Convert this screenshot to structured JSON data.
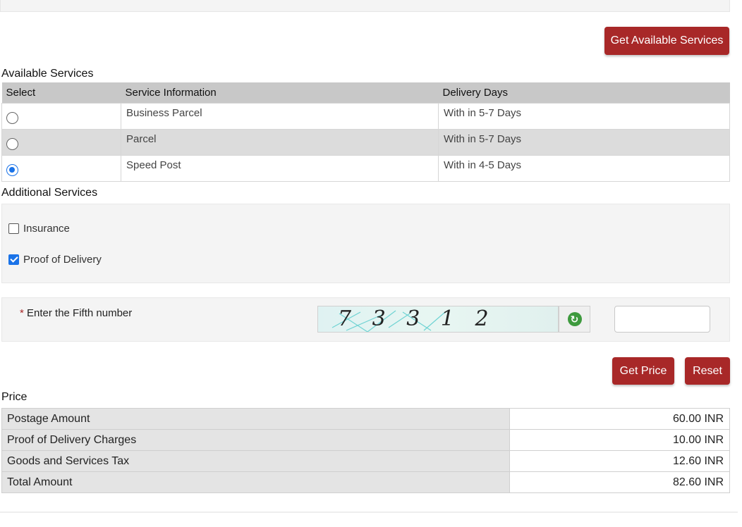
{
  "buttons": {
    "get_services": "Get Available Services",
    "get_price": "Get Price",
    "reset": "Reset"
  },
  "available_services": {
    "title": "Available Services",
    "headers": [
      "Select",
      "Service Information",
      "Delivery Days"
    ],
    "rows": [
      {
        "service": "Business Parcel",
        "days": "With in 5-7 Days",
        "selected": false
      },
      {
        "service": "Parcel",
        "days": "With in 5-7 Days",
        "selected": false
      },
      {
        "service": "Speed Post",
        "days": "With in 4-5 Days",
        "selected": true
      }
    ]
  },
  "additional_services": {
    "title": "Additional Services",
    "options": [
      {
        "label": "Insurance",
        "checked": false
      },
      {
        "label": "Proof of Delivery",
        "checked": true
      }
    ]
  },
  "captcha": {
    "required_mark": "*",
    "label": "Enter the Fifth number",
    "image_text": "7 3 3 1 2",
    "refresh_icon": "refresh-icon",
    "input_value": ""
  },
  "price": {
    "title": "Price",
    "rows": [
      {
        "label": "Postage Amount",
        "value": "60.00 INR"
      },
      {
        "label": "Proof of Delivery Charges",
        "value": "10.00 INR"
      },
      {
        "label": "Goods and Services Tax",
        "value": "12.60 INR"
      },
      {
        "label": "Total Amount",
        "value": "82.60 INR"
      }
    ]
  },
  "colors": {
    "accent": "#a82828",
    "radio_checked": "#1a73e8",
    "header_bg": "#c8c8c8"
  }
}
